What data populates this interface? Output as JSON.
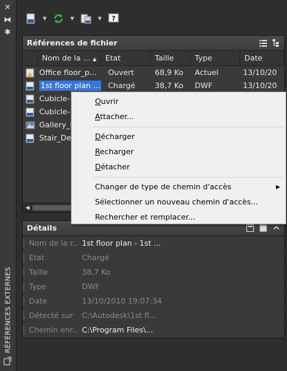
{
  "side_strip": {
    "title": "RÉFÉRENCES EXTERNES"
  },
  "files_panel": {
    "title": "Références de fichier",
    "columns": [
      "Nom de la ...",
      "Etat",
      "Taille",
      "Type",
      "Date"
    ],
    "rows": [
      {
        "name": "Office floor_p...",
        "state": "Ouvert",
        "size": "68,9 Ko",
        "type": "Actuel",
        "date": "13/10/20",
        "icon": "dwg-icon"
      },
      {
        "name": "1st floor plan ...",
        "state": "Chargé",
        "size": "38,7 Ko",
        "type": "DWF",
        "date": "13/10/20",
        "icon": "dwf-icon",
        "selected": true
      },
      {
        "name": "Cubicle-",
        "state": "",
        "size": "",
        "type": "",
        "date": "",
        "icon": "dwg-icon"
      },
      {
        "name": "Cubicle-",
        "state": "",
        "size": "",
        "type": "",
        "date": "",
        "icon": "dwg-icon"
      },
      {
        "name": "Gallery_E",
        "state": "",
        "size": "",
        "type": "",
        "date": "",
        "icon": "image-icon"
      },
      {
        "name": "Stair_Det",
        "state": "",
        "size": "",
        "type": "",
        "date": "",
        "icon": "dgn-icon"
      }
    ]
  },
  "details_panel": {
    "title": "Détails",
    "fields": [
      {
        "key": "Nom de la r...",
        "value": "1st floor plan - 1st ...",
        "active": true
      },
      {
        "key": "Etat",
        "value": "Chargé",
        "active": false
      },
      {
        "key": "Taille",
        "value": "38,7 Ko",
        "active": false
      },
      {
        "key": "Type",
        "value": "DWF",
        "active": false
      },
      {
        "key": "Date",
        "value": "13/10/2010 19:07:34",
        "active": false
      },
      {
        "key": "Détecté sur",
        "value": "C:\\Autodesk\\1st fl...",
        "active": false
      },
      {
        "key": "Chemin enr...",
        "value": "C:\\Program Files\\...",
        "active": true
      }
    ]
  },
  "context_menu": {
    "items": [
      {
        "label_u": "O",
        "label_rest": "uvrir"
      },
      {
        "label_u": "A",
        "label_rest": "ttacher..."
      },
      {
        "label_u": "D",
        "label_rest": "écharger"
      },
      {
        "label_u": "R",
        "label_rest": "echarger"
      },
      {
        "label_u": "D",
        "label_rest": "étacher"
      },
      {
        "label": "Changer de type de chemin d'accès"
      },
      {
        "label": "Sélectionner un nouveau chemin d'accès..."
      },
      {
        "label": "Rechercher et remplacer..."
      }
    ]
  },
  "colors": {
    "selection": "#3875d7",
    "refresh_green": "#3cb043"
  }
}
